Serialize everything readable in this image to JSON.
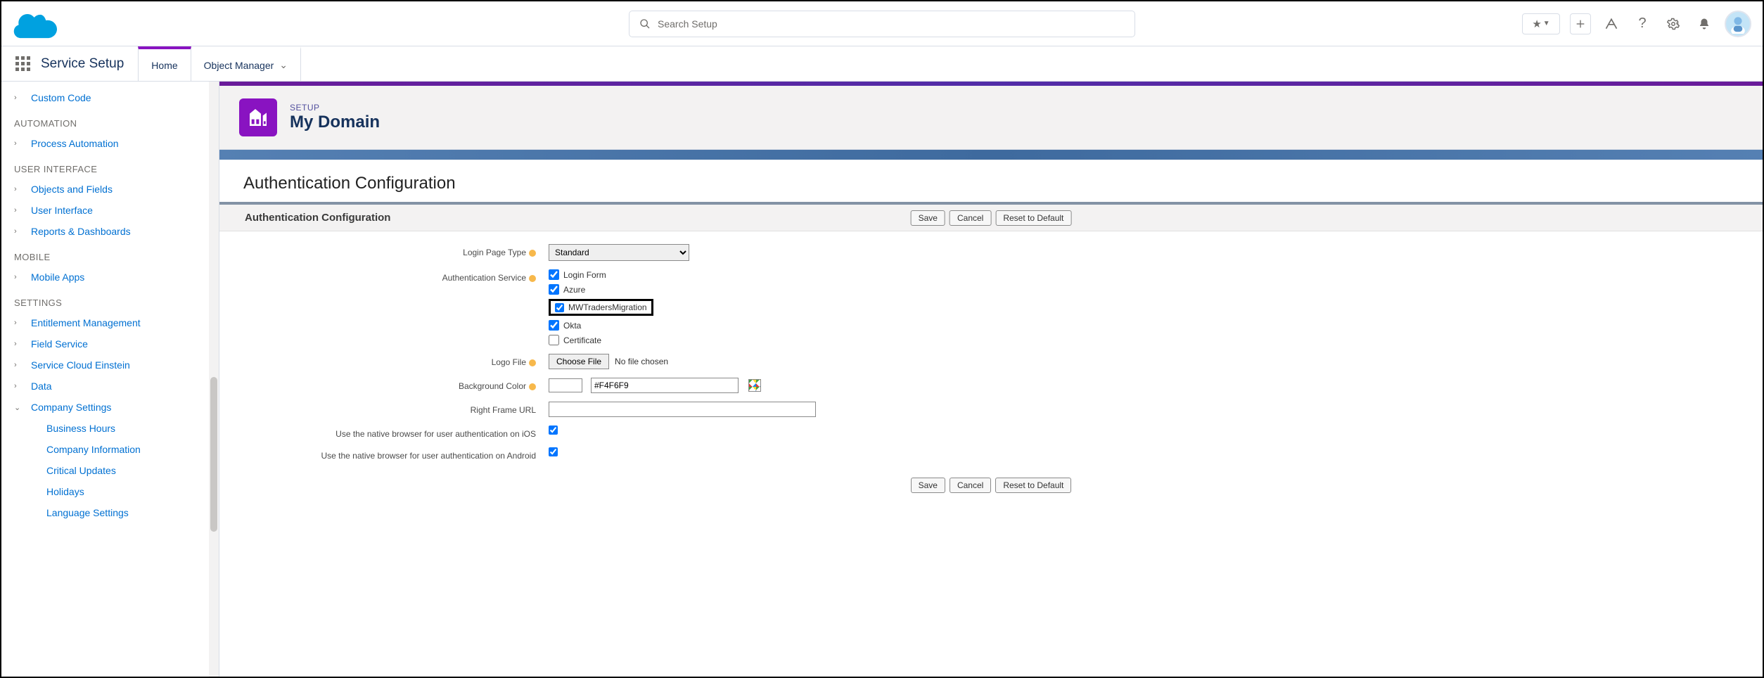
{
  "header": {
    "search_placeholder": "Search Setup"
  },
  "nav": {
    "app_title": "Service Setup",
    "tab_home": "Home",
    "tab_object_manager": "Object Manager"
  },
  "sidebar": {
    "items": [
      {
        "label": "Custom Code",
        "chev": "›",
        "type": "item"
      },
      {
        "label": "AUTOMATION",
        "type": "section"
      },
      {
        "label": "Process Automation",
        "chev": "›",
        "type": "item"
      },
      {
        "label": "USER INTERFACE",
        "type": "section"
      },
      {
        "label": "Objects and Fields",
        "chev": "›",
        "type": "item"
      },
      {
        "label": "User Interface",
        "chev": "›",
        "type": "item"
      },
      {
        "label": "Reports & Dashboards",
        "chev": "›",
        "type": "item"
      },
      {
        "label": "MOBILE",
        "type": "section"
      },
      {
        "label": "Mobile Apps",
        "chev": "›",
        "type": "item"
      },
      {
        "label": "SETTINGS",
        "type": "section"
      },
      {
        "label": "Entitlement Management",
        "chev": "›",
        "type": "item"
      },
      {
        "label": "Field Service",
        "chev": "›",
        "type": "item"
      },
      {
        "label": "Service Cloud Einstein",
        "chev": "›",
        "type": "item"
      },
      {
        "label": "Data",
        "chev": "›",
        "type": "item"
      },
      {
        "label": "Company Settings",
        "chev": "⌄",
        "type": "item"
      },
      {
        "label": "Business Hours",
        "type": "sub"
      },
      {
        "label": "Company Information",
        "type": "sub"
      },
      {
        "label": "Critical Updates",
        "type": "sub"
      },
      {
        "label": "Holidays",
        "type": "sub"
      },
      {
        "label": "Language Settings",
        "type": "sub"
      }
    ]
  },
  "page": {
    "eyebrow": "SETUP",
    "title": "My Domain",
    "section_title": "Authentication Configuration",
    "panel_title": "Authentication Configuration",
    "buttons": {
      "save": "Save",
      "cancel": "Cancel",
      "reset": "Reset to Default"
    },
    "form": {
      "login_page_type_label": "Login Page Type",
      "login_page_type_value": "Standard",
      "auth_service_label": "Authentication Service",
      "auth_services": [
        {
          "label": "Login Form",
          "checked": true
        },
        {
          "label": "Azure",
          "checked": true
        },
        {
          "label": "MWTradersMigration",
          "checked": true,
          "highlight": true
        },
        {
          "label": "Okta",
          "checked": true
        },
        {
          "label": "Certificate",
          "checked": false
        }
      ],
      "logo_file_label": "Logo File",
      "choose_file_btn": "Choose File",
      "no_file_text": "No file chosen",
      "bg_color_label": "Background Color",
      "bg_color_value": "#F4F6F9",
      "right_frame_label": "Right Frame URL",
      "right_frame_value": "",
      "native_ios_label": "Use the native browser for user authentication on iOS",
      "native_ios_checked": true,
      "native_android_label": "Use the native browser for user authentication on Android",
      "native_android_checked": true
    }
  }
}
